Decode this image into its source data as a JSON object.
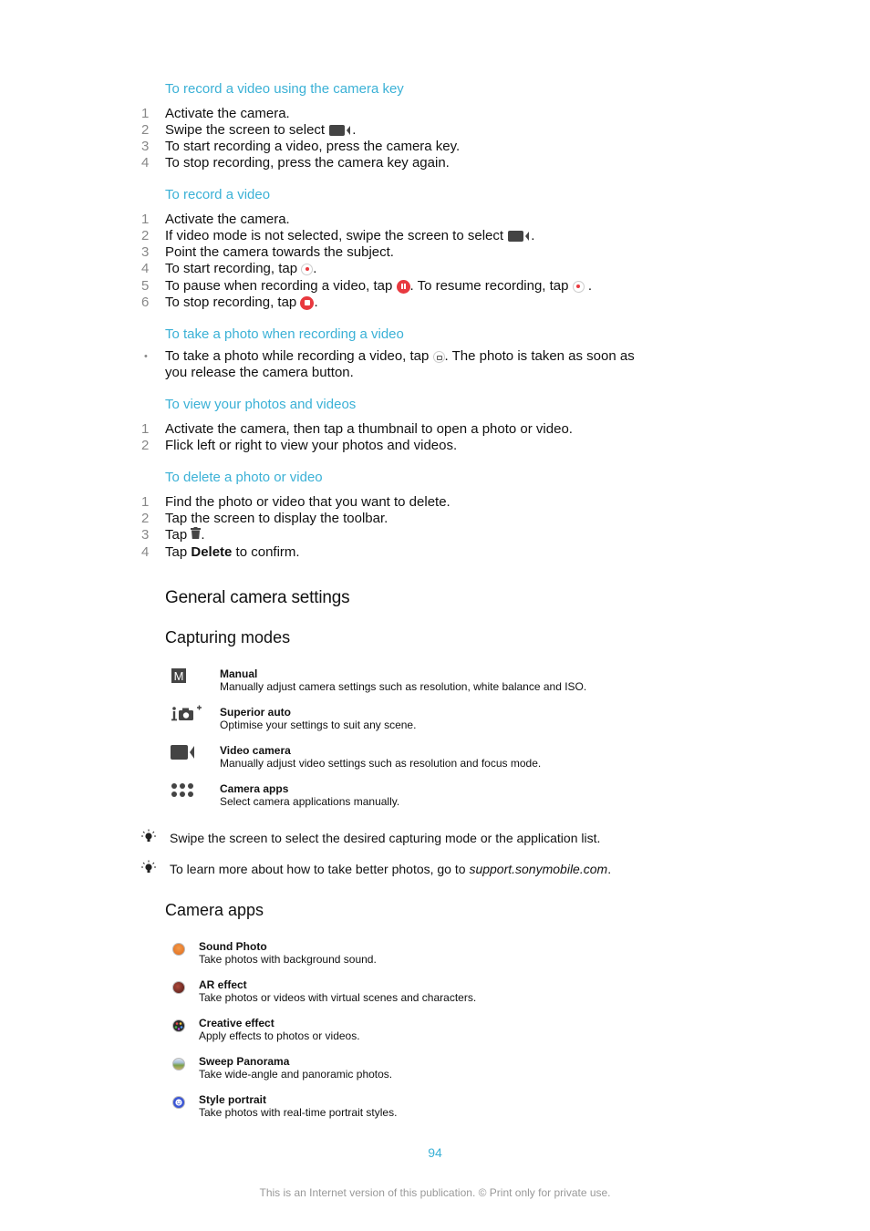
{
  "sections": [
    {
      "title": "To record a video using the camera key",
      "steps": [
        {
          "n": "1",
          "text": "Activate the camera."
        },
        {
          "n": "2",
          "text": "Swipe the screen to select",
          "icon": "video-camera-icon",
          "after": "."
        },
        {
          "n": "3",
          "text": "To start recording a video, press the camera key."
        },
        {
          "n": "4",
          "text": "To stop recording, press the camera key again."
        }
      ]
    },
    {
      "title": "To record a video",
      "steps": [
        {
          "n": "1",
          "text": "Activate the camera."
        },
        {
          "n": "2",
          "text": "If video mode is not selected, swipe the screen to select",
          "after": "."
        },
        {
          "n": "3",
          "text": "Point the camera towards the subject."
        },
        {
          "n": "4",
          "text": "To start recording, tap",
          "after": "."
        },
        {
          "n": "5",
          "text": "To pause when recording a video, tap",
          "mid": ". To resume recording, tap",
          "after": "."
        },
        {
          "n": "6",
          "text": "To stop recording, tap",
          "after": "."
        }
      ]
    },
    {
      "title": "To take a photo when recording a video",
      "bullet": "•",
      "text": "To take a photo while recording a video, tap",
      "after": ". The photo is taken as soon as",
      "line2": "you release the camera button."
    },
    {
      "title": "To view your photos and videos",
      "steps": [
        {
          "n": "1",
          "text": "Activate the camera, then tap a thumbnail to open a photo or video."
        },
        {
          "n": "2",
          "text": "Flick left or right to view your photos and videos."
        }
      ]
    },
    {
      "title": "To delete a photo or video",
      "steps": [
        {
          "n": "1",
          "text": "Find the photo or video that you want to delete."
        },
        {
          "n": "2",
          "text": "Tap the screen to display the toolbar."
        },
        {
          "n": "3",
          "text": "Tap",
          "after": "."
        },
        {
          "n": "4",
          "text": "Tap",
          "bold": "Delete",
          "after": " to confirm."
        }
      ]
    }
  ],
  "general": {
    "title": "General camera settings",
    "capturing_modes": {
      "title": "Capturing modes",
      "items": [
        {
          "icon": "manual-mode-icon",
          "glyph": "M",
          "name": "Manual",
          "desc": "Manually adjust camera settings such as resolution, white balance and ISO."
        },
        {
          "icon": "superior-auto-icon",
          "name": "Superior auto",
          "desc": "Optimise your settings to suit any scene."
        },
        {
          "icon": "video-camera-icon",
          "name": "Video camera",
          "desc": "Manually adjust video settings such as resolution and focus mode."
        },
        {
          "icon": "camera-apps-grid-icon",
          "name": "Camera apps",
          "desc": "Select camera applications manually."
        }
      ]
    },
    "tips": [
      {
        "icon": "lightbulb-tip-icon",
        "text": "Swipe the screen to select the desired capturing mode or the application list."
      },
      {
        "icon": "lightbulb-tip-icon",
        "text": "To learn more about how to take better photos, go to ",
        "link": "support.sonymobile.com",
        "after": "."
      }
    ],
    "camera_apps": {
      "title": "Camera apps",
      "items": [
        {
          "icon": "sound-photo-icon",
          "name": "Sound Photo",
          "desc": "Take photos with background sound.",
          "color": "#e8772a"
        },
        {
          "icon": "ar-effect-icon",
          "name": "AR effect",
          "desc": "Take photos or videos with virtual scenes and characters.",
          "color": "#7a2a22"
        },
        {
          "icon": "creative-effect-icon",
          "name": "Creative effect",
          "desc": "Apply effects to photos or videos.",
          "color": "#2a2a2a"
        },
        {
          "icon": "sweep-panorama-icon",
          "name": "Sweep Panorama",
          "desc": "Take wide-angle and panoramic photos.",
          "color": "#7aa04a"
        },
        {
          "icon": "style-portrait-icon",
          "name": "Style portrait",
          "desc": "Take photos with real-time portrait styles.",
          "color": "#3a55d6"
        }
      ]
    }
  },
  "footer": {
    "page_number": "94",
    "notice": "This is an Internet version of this publication. © Print only for private use."
  },
  "colors": {
    "heading_accent": "#3bb1d6",
    "record_red": "#e8393f",
    "step_number": "#888888"
  }
}
